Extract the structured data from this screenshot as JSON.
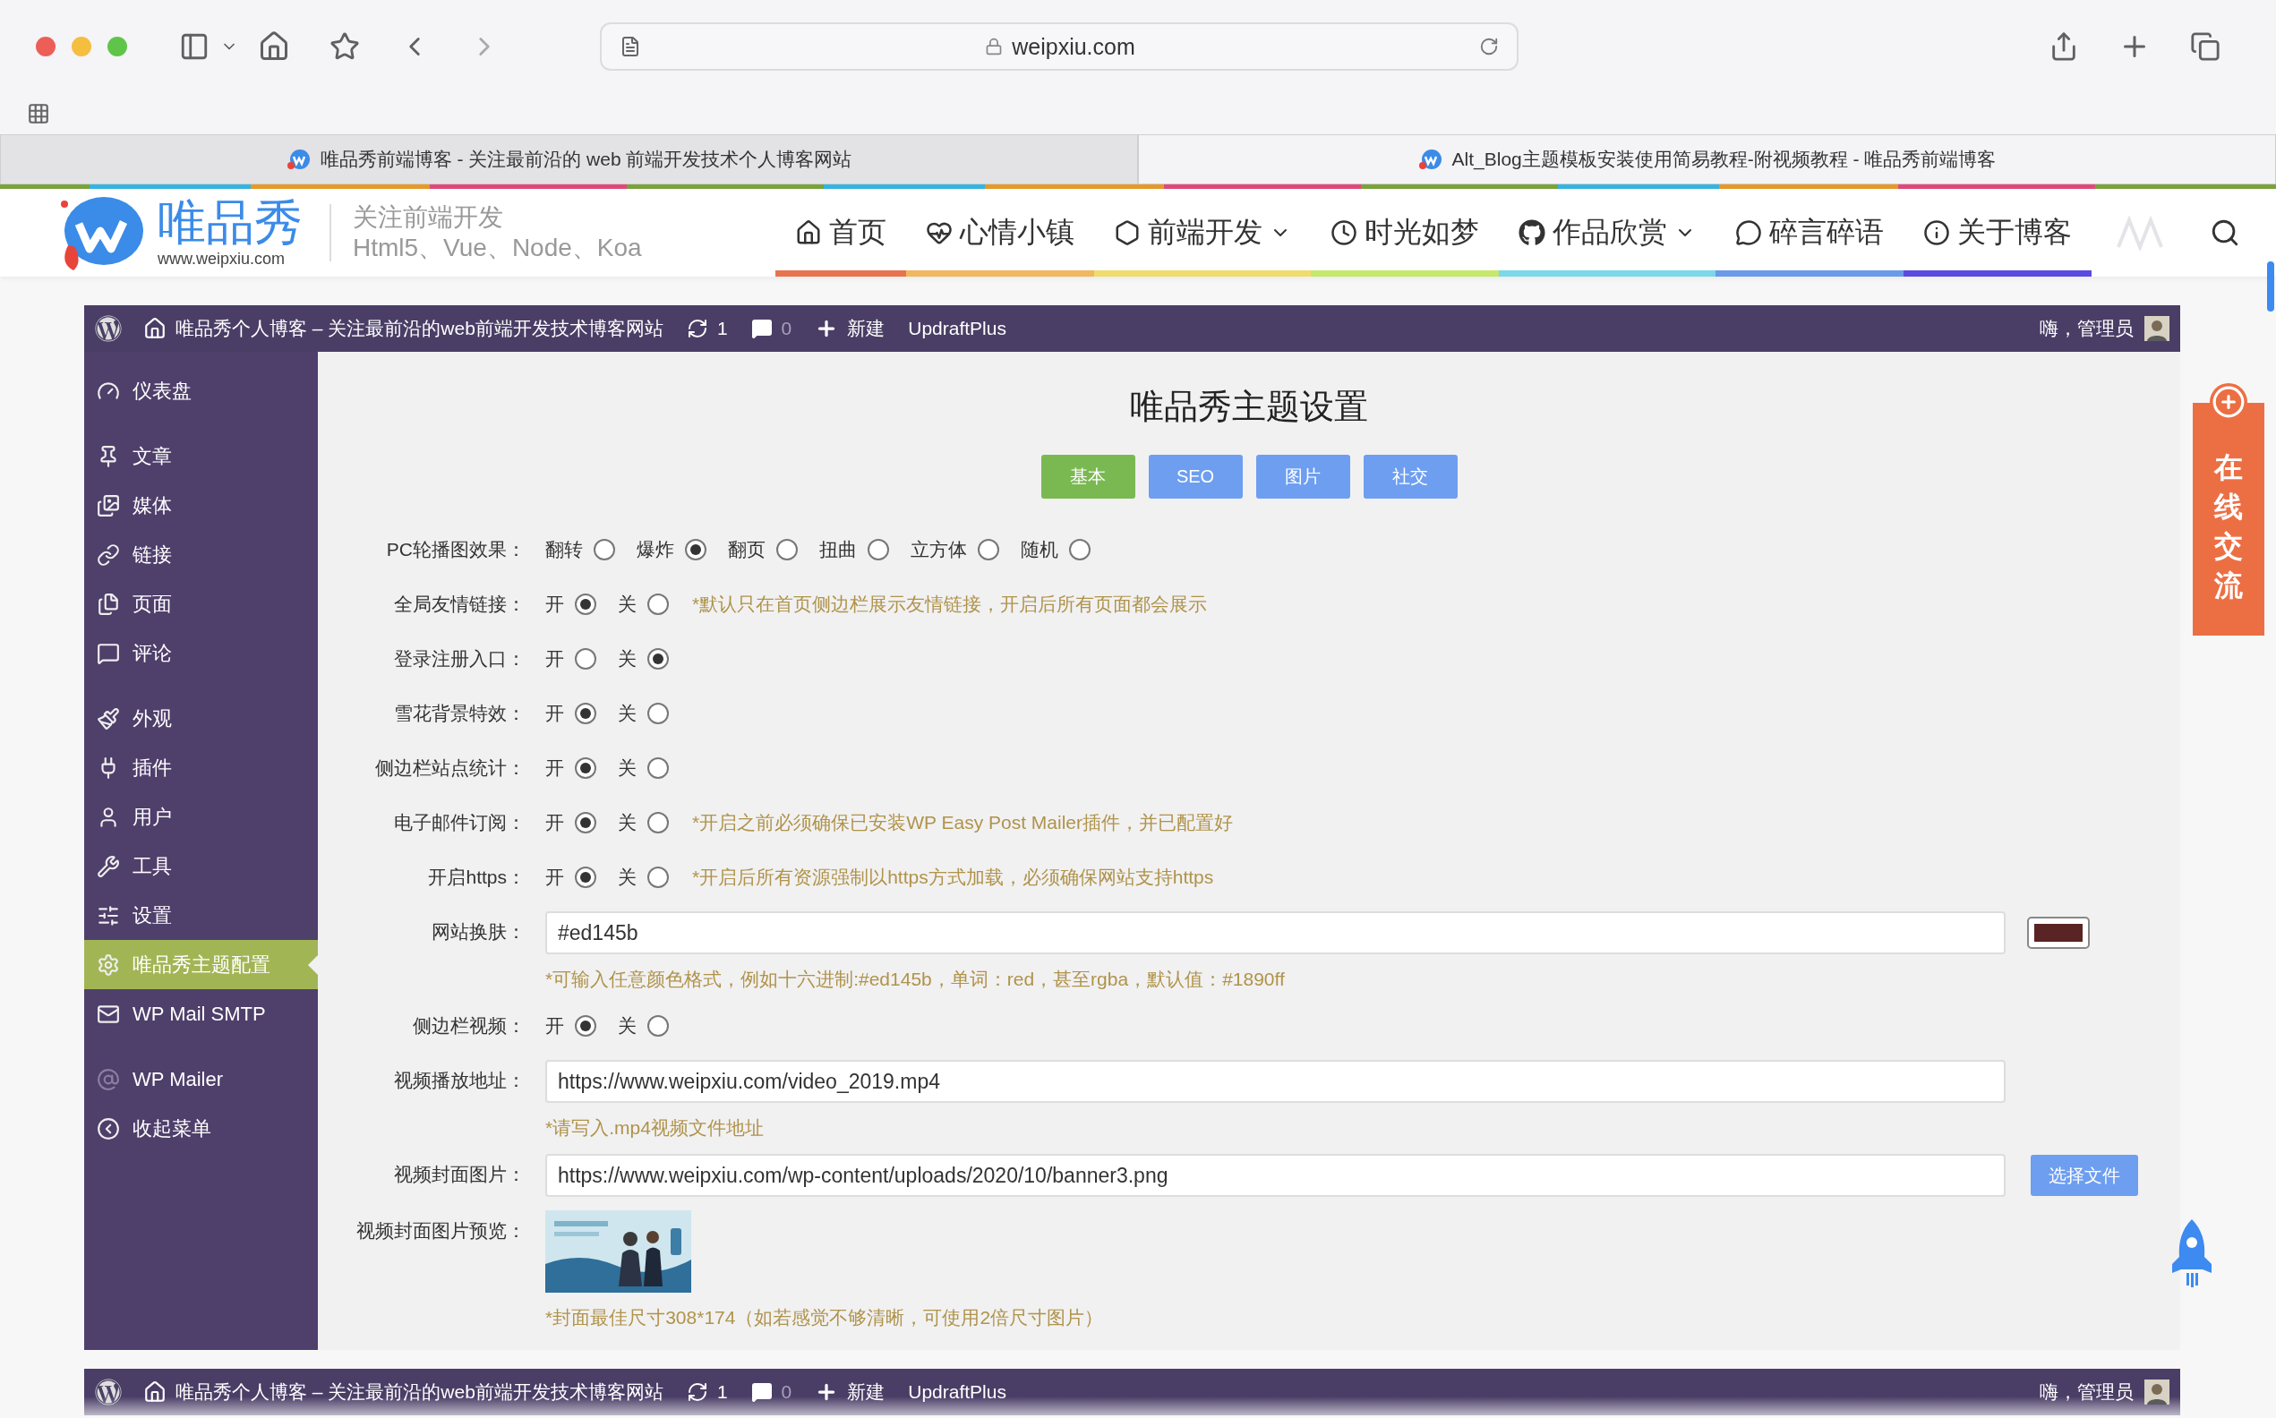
{
  "browser": {
    "url": "weipxiu.com",
    "tabs": [
      {
        "title": "唯品秀前端博客 - 关注最前沿的 web 前端开发技术个人博客网站",
        "selected": false
      },
      {
        "title": "Alt_Blog主题模板安装使用简易教程-附视频教程 - 唯品秀前端博客",
        "selected": true
      }
    ]
  },
  "site": {
    "logo_name": "唯品秀",
    "logo_url": "www.weipxiu.com",
    "tagline": "关注前端开发",
    "tagline_sub": "Html5、Vue、Node、Koa",
    "nav": [
      {
        "label": "首页",
        "dropdown": false,
        "color": "#e8734f"
      },
      {
        "label": "心情小镇",
        "dropdown": false,
        "color": "#f0b860"
      },
      {
        "label": "前端开发",
        "dropdown": true,
        "color": "#f0dc6c"
      },
      {
        "label": "时光如梦",
        "dropdown": false,
        "color": "#c6e86c"
      },
      {
        "label": "作品欣赏",
        "dropdown": true,
        "color": "#7ad8e8"
      },
      {
        "label": "碎言碎语",
        "dropdown": false,
        "color": "#6a9ae8"
      },
      {
        "label": "关于博客",
        "dropdown": false,
        "color": "#5a4ae0"
      }
    ]
  },
  "admin_bar": {
    "site_title": "唯品秀个人博客 – 关注最前沿的web前端开发技术博客网站",
    "updates": "1",
    "comments": "0",
    "new": "新建",
    "plugin": "UpdraftPlus",
    "greeting": "嗨，管理员"
  },
  "sidebar": {
    "groups": [
      {
        "items": [
          {
            "label": "仪表盘",
            "selected": false
          }
        ]
      },
      {
        "items": [
          {
            "label": "文章",
            "selected": false
          },
          {
            "label": "媒体",
            "selected": false
          },
          {
            "label": "链接",
            "selected": false
          },
          {
            "label": "页面",
            "selected": false
          },
          {
            "label": "评论",
            "selected": false
          }
        ]
      },
      {
        "items": [
          {
            "label": "外观",
            "selected": false
          },
          {
            "label": "插件",
            "selected": false
          },
          {
            "label": "用户",
            "selected": false
          },
          {
            "label": "工具",
            "selected": false
          },
          {
            "label": "设置",
            "selected": false
          },
          {
            "label": "唯品秀主题配置",
            "selected": true
          },
          {
            "label": "WP Mail SMTP",
            "selected": false
          }
        ]
      },
      {
        "items": [
          {
            "label": "WP Mailer",
            "selected": false
          },
          {
            "label": "收起菜单",
            "selected": false
          }
        ]
      }
    ]
  },
  "page": {
    "title": "唯品秀主题设置",
    "tabs": [
      {
        "label": "基本",
        "selected": true
      },
      {
        "label": "SEO",
        "selected": false
      },
      {
        "label": "图片",
        "selected": false
      },
      {
        "label": "社交",
        "selected": false
      }
    ],
    "settings": [
      {
        "kind": "radio",
        "label": "PC轮播图效果：",
        "options": [
          {
            "label": "翻转",
            "selected": false
          },
          {
            "label": "爆炸",
            "selected": true
          },
          {
            "label": "翻页",
            "selected": false
          },
          {
            "label": "扭曲",
            "selected": false
          },
          {
            "label": "立方体",
            "selected": false
          },
          {
            "label": "随机",
            "selected": false
          }
        ]
      },
      {
        "kind": "radio",
        "label": "全局友情链接：",
        "options": [
          {
            "label": "开",
            "selected": true
          },
          {
            "label": "关",
            "selected": false
          }
        ],
        "note": "*默认只在首页侧边栏展示友情链接，开启后所有页面都会展示"
      },
      {
        "kind": "radio",
        "label": "登录注册入口：",
        "options": [
          {
            "label": "开",
            "selected": false
          },
          {
            "label": "关",
            "selected": true
          }
        ]
      },
      {
        "kind": "radio",
        "label": "雪花背景特效：",
        "options": [
          {
            "label": "开",
            "selected": true
          },
          {
            "label": "关",
            "selected": false
          }
        ]
      },
      {
        "kind": "radio",
        "label": "侧边栏站点统计：",
        "options": [
          {
            "label": "开",
            "selected": true
          },
          {
            "label": "关",
            "selected": false
          }
        ]
      },
      {
        "kind": "radio",
        "label": "电子邮件订阅：",
        "options": [
          {
            "label": "开",
            "selected": true
          },
          {
            "label": "关",
            "selected": false
          }
        ],
        "note": "*开启之前必须确保已安装WP Easy Post Mailer插件，并已配置好"
      },
      {
        "kind": "radio",
        "label": "开启https：",
        "options": [
          {
            "label": "开",
            "selected": true
          },
          {
            "label": "关",
            "selected": false
          }
        ],
        "note": "*开启后所有资源强制以https方式加载，必须确保网站支持https"
      },
      {
        "kind": "text",
        "label": "网站换肤：",
        "value": "#ed145b",
        "color": "#5a2424",
        "note": "*可输入任意颜色格式，例如十六进制:#ed145b，单词：red，甚至rgba，默认值：#1890ff"
      },
      {
        "kind": "radio",
        "label": "侧边栏视频：",
        "options": [
          {
            "label": "开",
            "selected": true
          },
          {
            "label": "关",
            "selected": false
          }
        ]
      },
      {
        "kind": "text",
        "label": "视频播放地址：",
        "value": "https://www.weipxiu.com/video_2019.mp4",
        "note": "*请写入.mp4视频文件地址"
      },
      {
        "kind": "text",
        "label": "视频封面图片：",
        "value": "https://www.weipxiu.com/wp-content/uploads/2020/10/banner3.png",
        "button": "选择文件"
      },
      {
        "kind": "preview",
        "label": "视频封面图片预览：",
        "note": "*封面最佳尺寸308*174（如若感觉不够清晰，可使用2倍尺寸图片）"
      }
    ]
  },
  "chat_widget": {
    "label": "在线交流"
  },
  "bottom_admin_bar": {
    "site_title": "唯品秀个人博客 – 关注最前沿的web前端开发技术博客网站",
    "updates": "1",
    "comments": "0",
    "new": "新建",
    "plugin": "UpdraftPlus",
    "greeting": "嗨，管理员"
  }
}
